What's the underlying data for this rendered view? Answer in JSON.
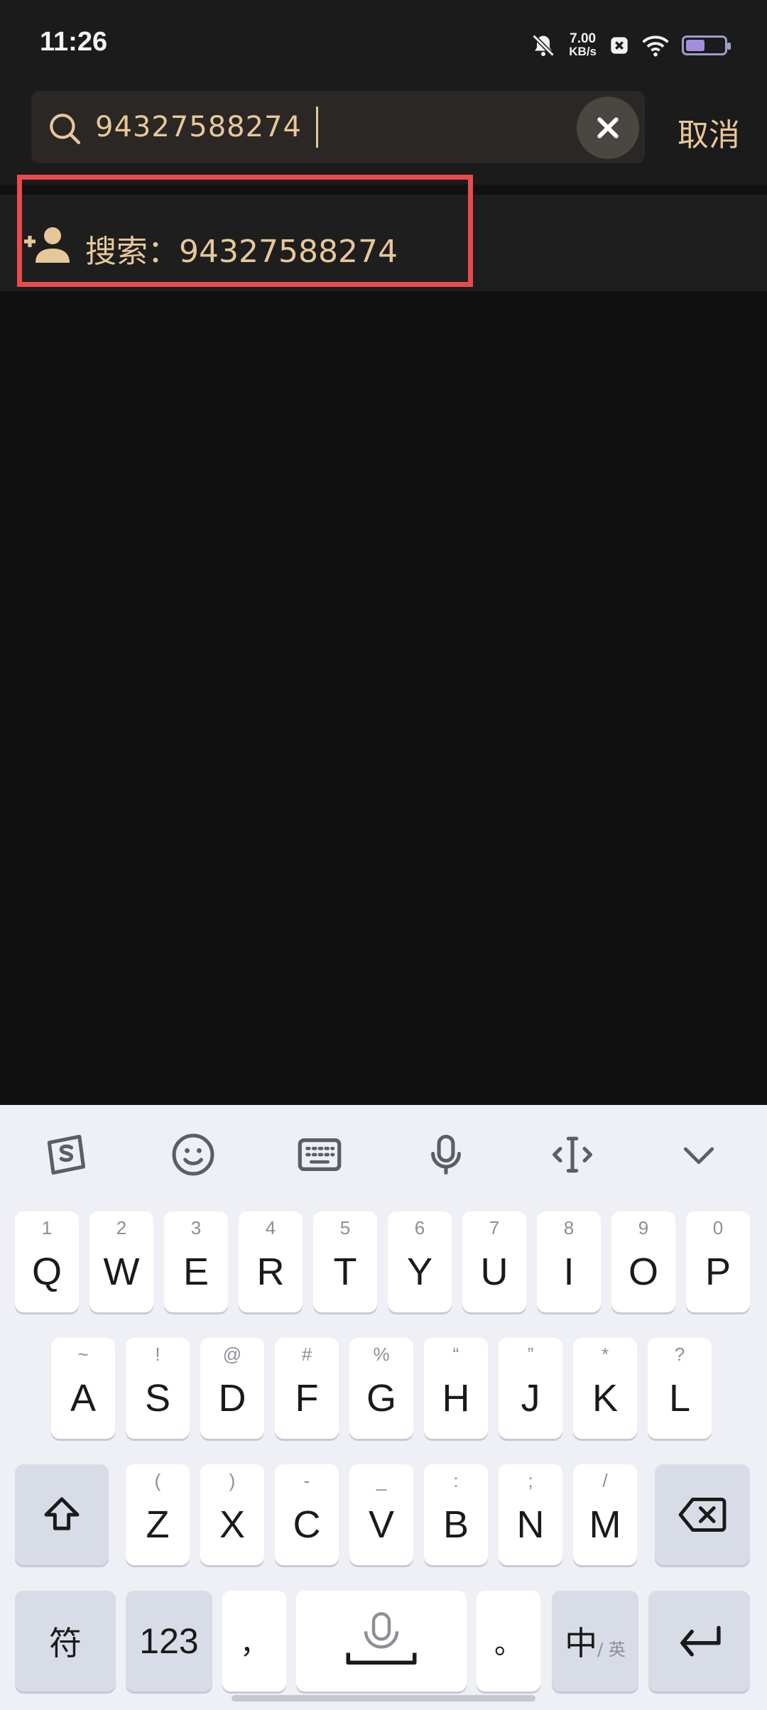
{
  "status_bar": {
    "time": "11:26",
    "net_speed_value": "7.00",
    "net_speed_unit": "KB/s",
    "icons": [
      "bell-off-icon",
      "notification-x-icon",
      "wifi-icon",
      "battery-icon"
    ]
  },
  "search": {
    "query": "94327588274",
    "clear_icon": "close-icon",
    "cancel_label": "取消"
  },
  "result": {
    "label": "搜索：94327588274",
    "icon": "add-user-icon"
  },
  "keyboard": {
    "toolbar": [
      "sogou-logo-icon",
      "emoji-icon",
      "keyboard-icon",
      "microphone-icon",
      "cursor-move-icon",
      "hide-keyboard-icon"
    ],
    "row1": [
      {
        "main": "Q",
        "sub": "1"
      },
      {
        "main": "W",
        "sub": "2"
      },
      {
        "main": "E",
        "sub": "3"
      },
      {
        "main": "R",
        "sub": "4"
      },
      {
        "main": "T",
        "sub": "5"
      },
      {
        "main": "Y",
        "sub": "6"
      },
      {
        "main": "U",
        "sub": "7"
      },
      {
        "main": "I",
        "sub": "8"
      },
      {
        "main": "O",
        "sub": "9"
      },
      {
        "main": "P",
        "sub": "0"
      }
    ],
    "row2": [
      {
        "main": "A",
        "sub": "~"
      },
      {
        "main": "S",
        "sub": "!"
      },
      {
        "main": "D",
        "sub": "@"
      },
      {
        "main": "F",
        "sub": "#"
      },
      {
        "main": "G",
        "sub": "%"
      },
      {
        "main": "H",
        "sub": "“"
      },
      {
        "main": "J",
        "sub": "”"
      },
      {
        "main": "K",
        "sub": "*"
      },
      {
        "main": "L",
        "sub": "?"
      }
    ],
    "row3": [
      {
        "main": "Z",
        "sub": "("
      },
      {
        "main": "X",
        "sub": ")"
      },
      {
        "main": "C",
        "sub": "-"
      },
      {
        "main": "V",
        "sub": "_"
      },
      {
        "main": "B",
        "sub": ":"
      },
      {
        "main": "N",
        "sub": ";"
      },
      {
        "main": "M",
        "sub": "/"
      }
    ],
    "symbols_label": "符",
    "numbers_label": "123",
    "comma_label": "，",
    "period_label": "。",
    "lang_main": "中",
    "lang_sub": "/ 英"
  },
  "colors": {
    "accent": "#e7c79a",
    "highlight": "#e84b4b",
    "background": "#111111"
  }
}
